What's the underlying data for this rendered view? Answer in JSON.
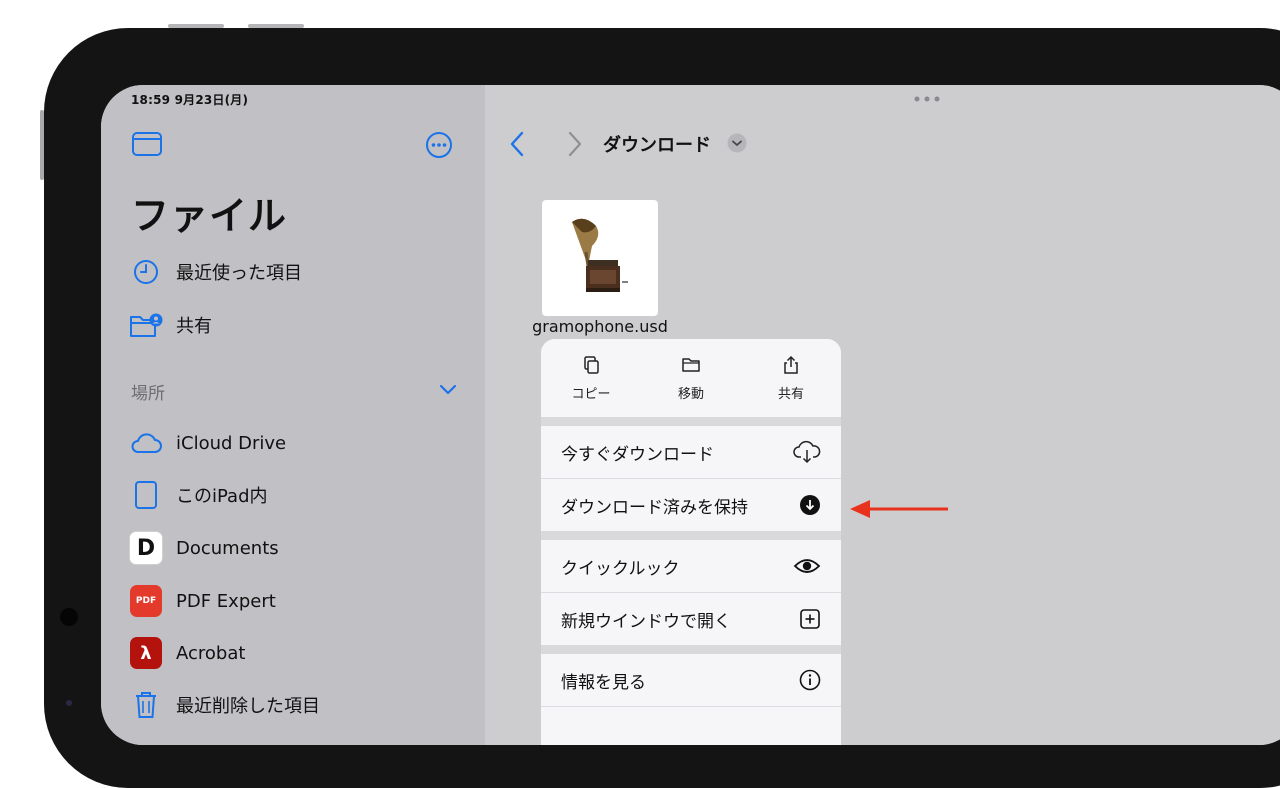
{
  "status": {
    "time_date": "18:59  9月23日(月)"
  },
  "sidebar": {
    "title": "ファイル",
    "top_items": [
      {
        "label": "最近使った項目",
        "icon": "clock-icon"
      },
      {
        "label": "共有",
        "icon": "shared-folder-icon"
      }
    ],
    "section_label": "場所",
    "locations": [
      {
        "label": "iCloud Drive",
        "icon": "cloud-icon"
      },
      {
        "label": "このiPad内",
        "icon": "ipad-icon"
      },
      {
        "label": "Documents",
        "icon": "documents-app-icon"
      },
      {
        "label": "PDF Expert",
        "icon": "pdf-expert-app-icon"
      },
      {
        "label": "Acrobat",
        "icon": "acrobat-app-icon"
      },
      {
        "label": "最近削除した項目",
        "icon": "trash-icon"
      }
    ]
  },
  "main": {
    "breadcrumb": "ダウンロード",
    "file": {
      "name": "gramophone.usd",
      "thumbnail": "gramophone-thumbnail"
    }
  },
  "context_menu": {
    "quick_actions": [
      {
        "label": "コピー",
        "icon": "copy-icon"
      },
      {
        "label": "移動",
        "icon": "folder-icon"
      },
      {
        "label": "共有",
        "icon": "share-icon"
      }
    ],
    "items": [
      {
        "label": "今すぐダウンロード",
        "icon": "icloud-download-icon"
      },
      {
        "label": "ダウンロード済みを保持",
        "icon": "download-circle-icon"
      },
      {
        "label": "クイックルック",
        "icon": "eye-icon"
      },
      {
        "label": "新規ウインドウで開く",
        "icon": "new-window-icon"
      },
      {
        "label": "情報を見る",
        "icon": "info-icon"
      }
    ]
  },
  "annotation": {
    "arrow_color": "#e8321e"
  },
  "colors": {
    "accent": "#1a73e8",
    "sidebar_bg": "#c1c1c5",
    "main_bg": "#cdcdcf"
  }
}
